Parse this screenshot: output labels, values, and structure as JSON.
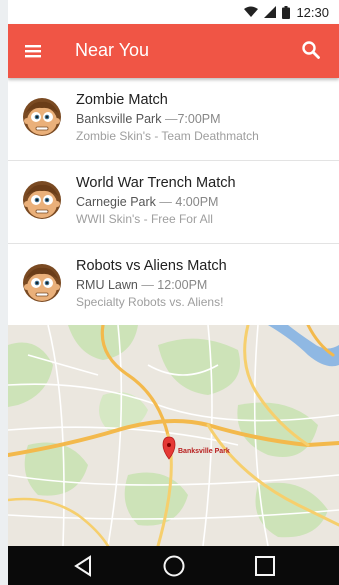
{
  "status_bar": {
    "time": "12:30"
  },
  "app_bar": {
    "title": "Near You"
  },
  "events": [
    {
      "title": "Zombie Match",
      "location": "Banksville Park",
      "time": "7:00PM",
      "description": "Zombie Skin's - Team Deathmatch"
    },
    {
      "title": "World War Trench Match",
      "location": "Carnegie Park",
      "time": "4:00PM",
      "description": "WWII Skin's - Free For All"
    },
    {
      "title": "Robots vs Aliens Match",
      "location": "RMU Lawn",
      "time": "12:00PM",
      "description": "Specialty Robots vs. Aliens!"
    }
  ],
  "map": {
    "marker_label": "Banksville Park"
  },
  "colors": {
    "app_bar": "#f05545",
    "nav_bar": "#0a0a0a",
    "map_marker": "#e53935"
  }
}
